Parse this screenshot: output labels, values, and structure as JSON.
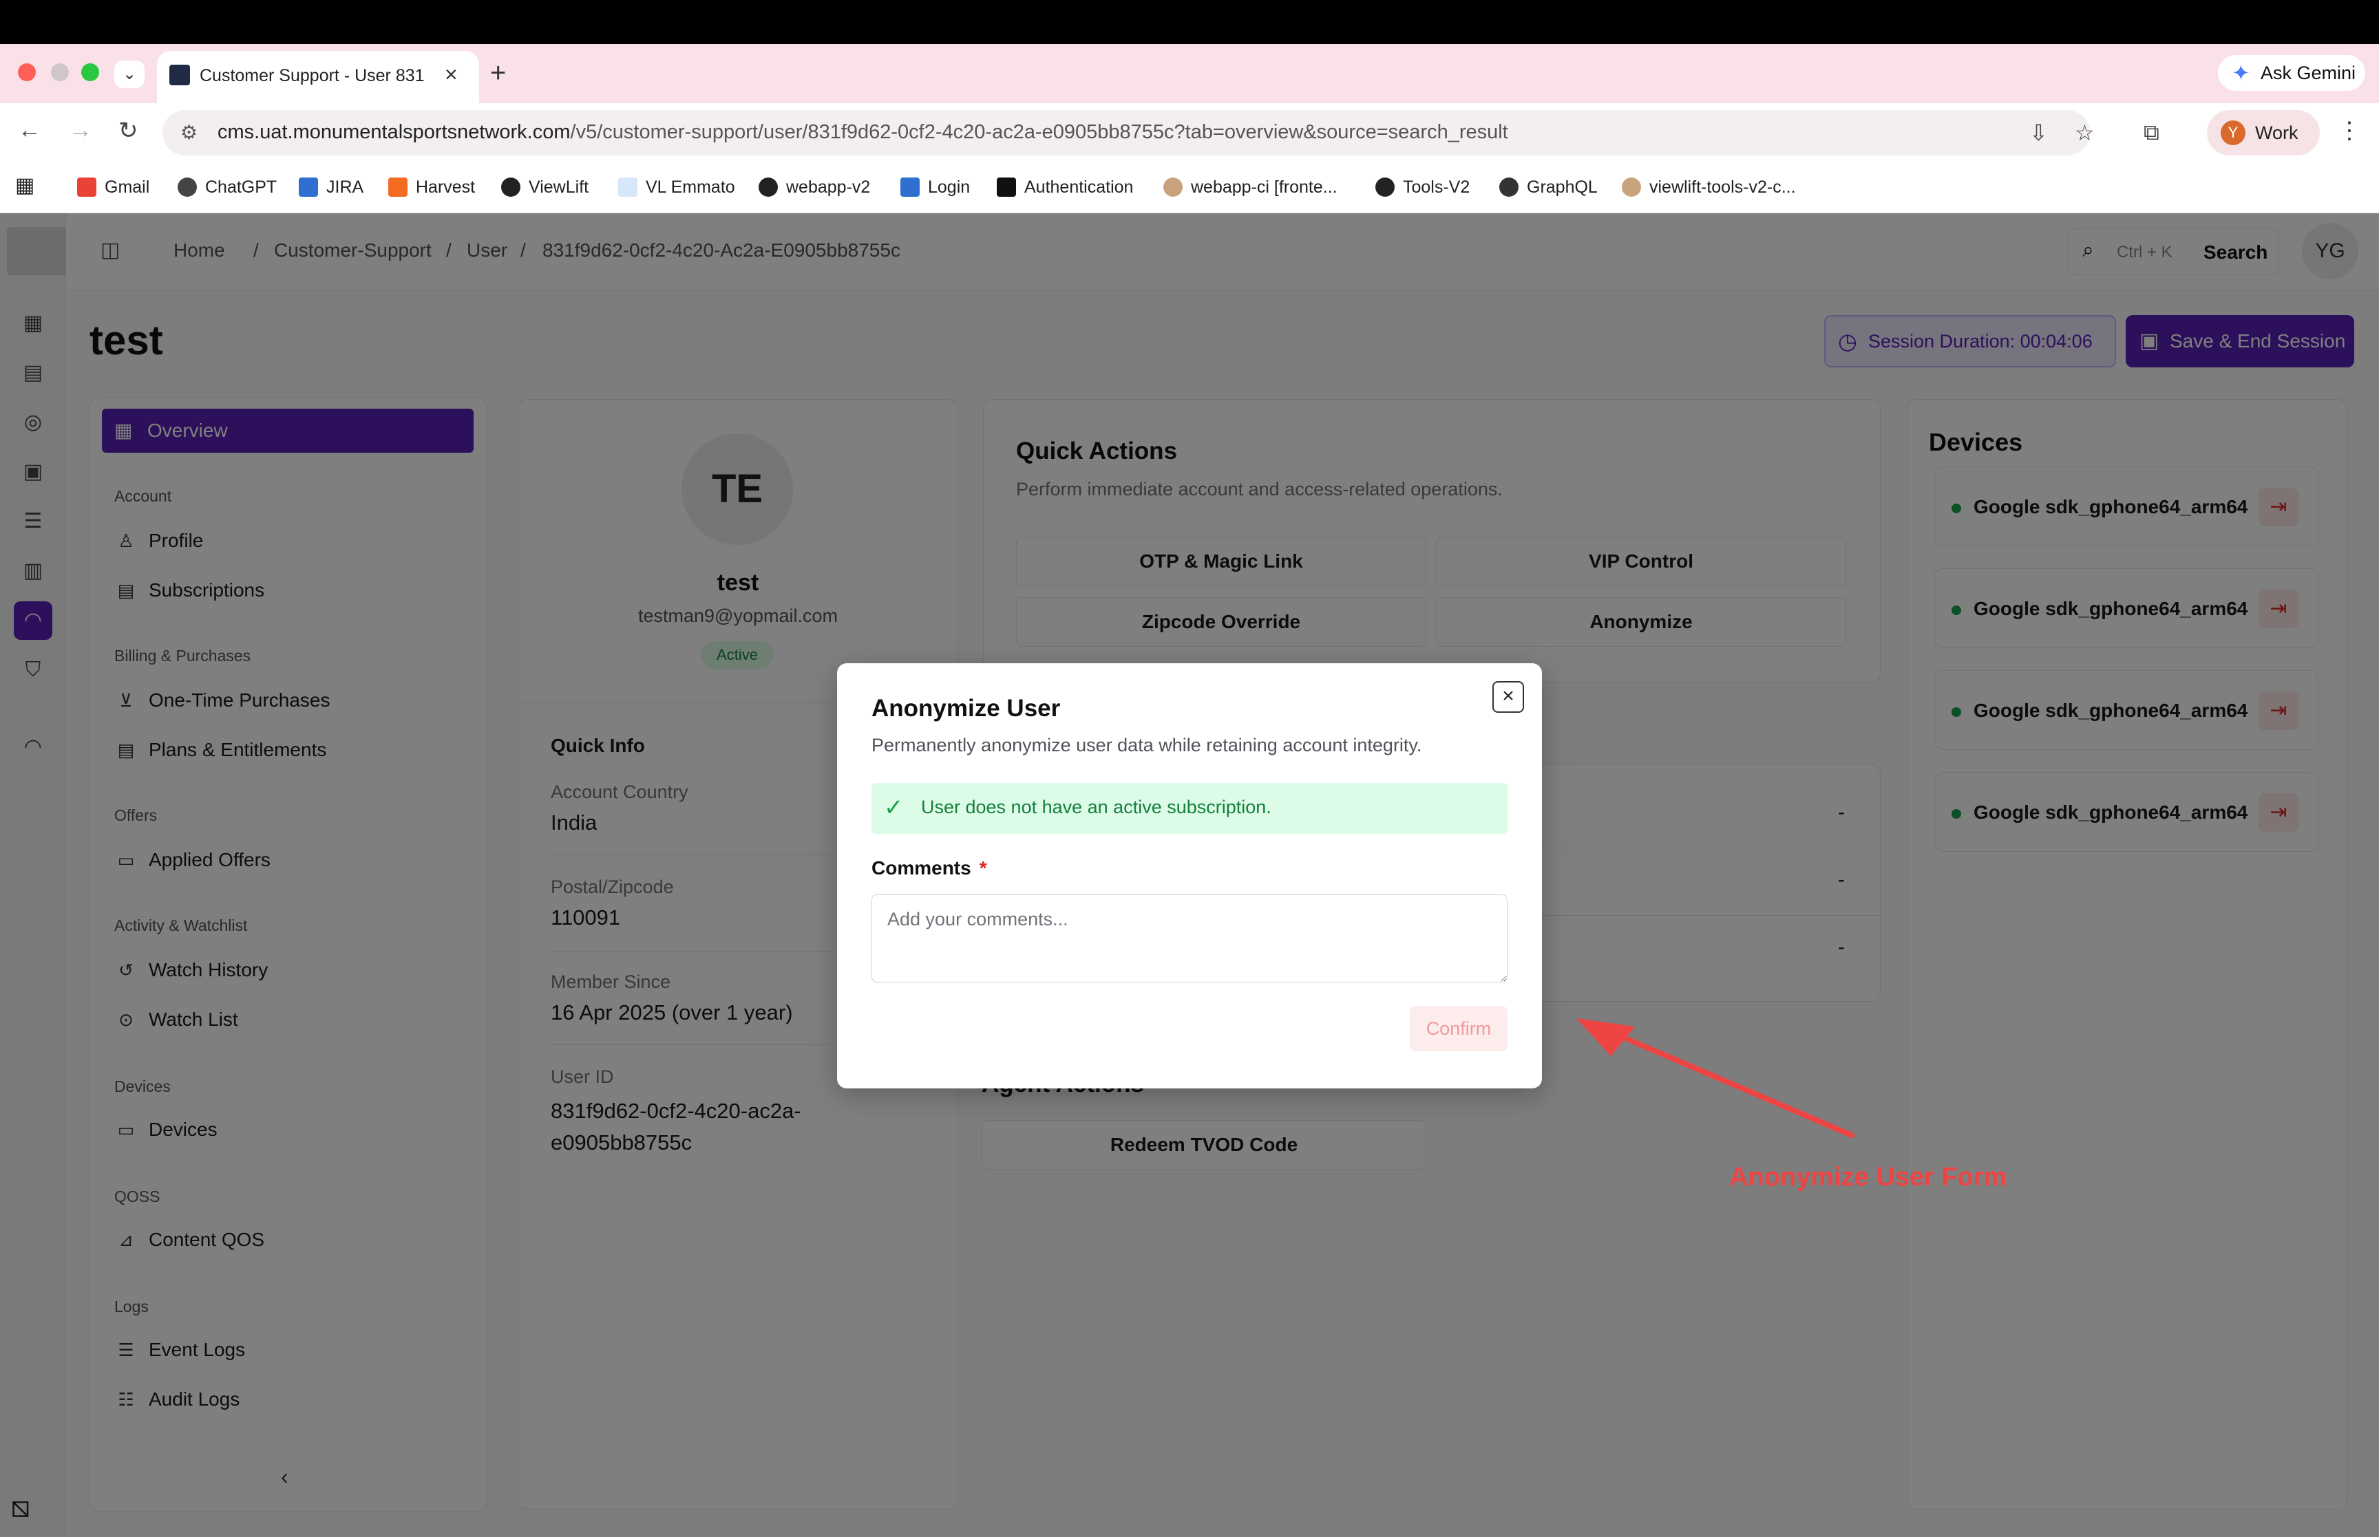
{
  "browser": {
    "tab_title": "Customer Support - User 831",
    "new_tab": "+",
    "ask_gemini": "Ask Gemini",
    "url_host": "cms.uat.monumentalsportsnetwork.com",
    "url_path": "/v5/customer-support/user/831f9d62-0cf2-4c20-ac2a-e0905bb8755c?tab=overview&source=search_result",
    "profile_initial": "Y",
    "profile_label": "Work",
    "bookmarks": [
      "Gmail",
      "ChatGPT",
      "JIRA",
      "Harvest",
      "ViewLift",
      "VL Emmato",
      "webapp-v2",
      "Login",
      "Authentication",
      "webapp-ci [fronte...",
      "Tools-V2",
      "GraphQL",
      "viewlift-tools-v2-c..."
    ]
  },
  "header": {
    "breadcrumbs": [
      "Home",
      "/",
      "Customer-Support",
      "/",
      "User",
      "/",
      "831f9d62-0cf2-4c20-Ac2a-E0905bb8755c"
    ],
    "search_kbd": "Ctrl  +  K",
    "search_label": "Search",
    "avatar": "YG"
  },
  "page": {
    "title": "test",
    "session_label": "Session Duration:  00:04:06",
    "save_end": "Save & End Session"
  },
  "nav": {
    "overview": "Overview",
    "sections": [
      {
        "title": "Account",
        "items": [
          "Profile",
          "Subscriptions"
        ]
      },
      {
        "title": "Billing & Purchases",
        "items": [
          "One-Time Purchases",
          "Plans & Entitlements"
        ]
      },
      {
        "title": "Offers",
        "items": [
          "Applied Offers"
        ]
      },
      {
        "title": "Activity & Watchlist",
        "items": [
          "Watch History",
          "Watch List"
        ]
      },
      {
        "title": "Devices",
        "items": [
          "Devices"
        ]
      },
      {
        "title": "QOSS",
        "items": [
          "Content QOS"
        ]
      },
      {
        "title": "Logs",
        "items": [
          "Event Logs",
          "Audit Logs"
        ]
      }
    ],
    "collapse": "‹"
  },
  "user": {
    "initials": "TE",
    "name": "test",
    "email": "testman9@yopmail.com",
    "status": "Active",
    "quick_info_title": "Quick Info",
    "fields": [
      {
        "label": "Account Country",
        "value": "India"
      },
      {
        "label": "Postal/Zipcode",
        "value": "110091"
      },
      {
        "label": "Member Since",
        "value": "16 Apr 2025 (over 1 year)"
      },
      {
        "label": "User ID",
        "value": "831f9d62-0cf2-4c20-ac2a-\ne0905bb8755c"
      }
    ]
  },
  "quick_actions": {
    "title": "Quick Actions",
    "desc": "Perform immediate account and access-related operations.",
    "buttons": [
      "OTP & Magic Link",
      "VIP Control",
      "Zipcode Override",
      "Anonymize"
    ]
  },
  "status_rows": [
    "-",
    "-",
    "-"
  ],
  "agent_actions": {
    "title": "Agent Actions",
    "redeem": "Redeem TVOD Code"
  },
  "devices": {
    "title": "Devices",
    "items": [
      "Google sdk_gphone64_arm64",
      "Google sdk_gphone64_arm64",
      "Google sdk_gphone64_arm64",
      "Google sdk_gphone64_arm64"
    ]
  },
  "modal": {
    "title": "Anonymize User",
    "desc": "Permanently anonymize user data while retaining account integrity.",
    "notice": "User does not have an active subscription.",
    "comments_label": "Comments",
    "required": "*",
    "placeholder": "Add your comments...",
    "confirm": "Confirm",
    "close": "×"
  },
  "annotation": {
    "label": "Anonymize User Form"
  },
  "colors": {
    "brand": "#5b21b6",
    "success": "#16a34a",
    "danger": "#dc2626",
    "annotation": "#ef4444"
  }
}
